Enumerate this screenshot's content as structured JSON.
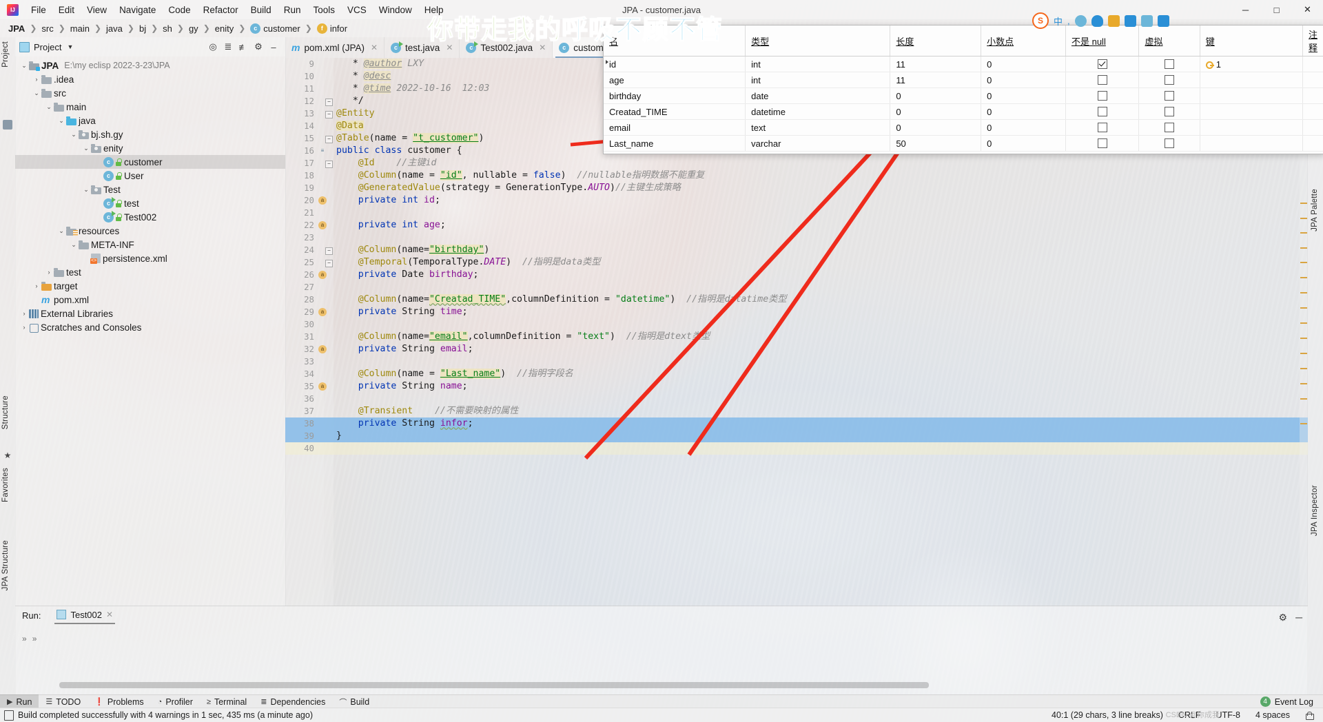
{
  "window": {
    "title": "JPA - customer.java",
    "minimize": "─",
    "maximize": "□",
    "close": "✕"
  },
  "menu": [
    {
      "label": "File"
    },
    {
      "label": "Edit"
    },
    {
      "label": "View"
    },
    {
      "label": "Navigate"
    },
    {
      "label": "Code"
    },
    {
      "label": "Refactor"
    },
    {
      "label": "Build"
    },
    {
      "label": "Run"
    },
    {
      "label": "Tools"
    },
    {
      "label": "VCS"
    },
    {
      "label": "Window"
    },
    {
      "label": "Help"
    }
  ],
  "breadcrumb": [
    {
      "label": "JPA",
      "icon": ""
    },
    {
      "label": "src",
      "icon": ""
    },
    {
      "label": "main",
      "icon": ""
    },
    {
      "label": "java",
      "icon": ""
    },
    {
      "label": "bj",
      "icon": ""
    },
    {
      "label": "sh",
      "icon": ""
    },
    {
      "label": "gy",
      "icon": ""
    },
    {
      "label": "enity",
      "icon": ""
    },
    {
      "label": "customer",
      "icon": "c"
    },
    {
      "label": "infor",
      "icon": "f"
    }
  ],
  "left_strip": [
    {
      "label": "Project"
    },
    {
      "label": "Structure"
    },
    {
      "label": "Favorites"
    },
    {
      "label": "JPA Structure"
    }
  ],
  "right_strip": [
    {
      "label": "JPA Palette"
    },
    {
      "label": "JPA Inspector"
    }
  ],
  "project_panel": {
    "title": "Project",
    "tree": [
      {
        "depth": 0,
        "arrow": "⌄",
        "icon": "mod",
        "label": "JPA",
        "bold": true,
        "sub": "E:\\my eclisp 2022-3-23\\JPA"
      },
      {
        "depth": 1,
        "arrow": "›",
        "icon": "folder",
        "label": ".idea",
        "bold": false,
        "sub": ""
      },
      {
        "depth": 1,
        "arrow": "⌄",
        "icon": "folder",
        "label": "src",
        "bold": false,
        "sub": ""
      },
      {
        "depth": 2,
        "arrow": "⌄",
        "icon": "folder",
        "label": "main",
        "bold": false,
        "sub": ""
      },
      {
        "depth": 3,
        "arrow": "⌄",
        "icon": "blue",
        "label": "java",
        "bold": false,
        "sub": ""
      },
      {
        "depth": 4,
        "arrow": "⌄",
        "icon": "pkg",
        "label": "bj.sh.gy",
        "bold": false,
        "sub": ""
      },
      {
        "depth": 5,
        "arrow": "⌄",
        "icon": "pkg",
        "label": "enity",
        "bold": false,
        "sub": ""
      },
      {
        "depth": 6,
        "arrow": "",
        "icon": "class",
        "label": "customer",
        "bold": false,
        "sub": "",
        "selected": true
      },
      {
        "depth": 6,
        "arrow": "",
        "icon": "class",
        "label": "User",
        "bold": false,
        "sub": ""
      },
      {
        "depth": 5,
        "arrow": "⌄",
        "icon": "pkg",
        "label": "Test",
        "bold": false,
        "sub": ""
      },
      {
        "depth": 6,
        "arrow": "",
        "icon": "class-run",
        "label": "test",
        "bold": false,
        "sub": ""
      },
      {
        "depth": 6,
        "arrow": "",
        "icon": "class-run",
        "label": "Test002",
        "bold": false,
        "sub": ""
      },
      {
        "depth": 3,
        "arrow": "⌄",
        "icon": "res",
        "label": "resources",
        "bold": false,
        "sub": ""
      },
      {
        "depth": 4,
        "arrow": "⌄",
        "icon": "folder",
        "label": "META-INF",
        "bold": false,
        "sub": ""
      },
      {
        "depth": 5,
        "arrow": "",
        "icon": "xml",
        "label": "persistence.xml",
        "bold": false,
        "sub": ""
      },
      {
        "depth": 2,
        "arrow": "›",
        "icon": "folder",
        "label": "test",
        "bold": false,
        "sub": ""
      },
      {
        "depth": 1,
        "arrow": "›",
        "icon": "target",
        "label": "target",
        "bold": false,
        "sub": ""
      },
      {
        "depth": 1,
        "arrow": "",
        "icon": "maven",
        "label": "pom.xml",
        "bold": false,
        "sub": ""
      },
      {
        "depth": 0,
        "arrow": "›",
        "icon": "lib",
        "label": "External Libraries",
        "bold": false,
        "sub": ""
      },
      {
        "depth": 0,
        "arrow": "›",
        "icon": "scratch",
        "label": "Scratches and Consoles",
        "bold": false,
        "sub": ""
      }
    ]
  },
  "editor": {
    "tabs": [
      {
        "label": "pom.xml (JPA)",
        "icon": "m",
        "active": false
      },
      {
        "label": "test.java",
        "icon": "c-run",
        "active": false
      },
      {
        "label": "Test002.java",
        "icon": "c-run",
        "active": false
      },
      {
        "label": "customer.java",
        "icon": "c",
        "active": true
      }
    ],
    "first_line": 9,
    "lines": [
      {
        "n": 9,
        "html": "   * <s class='jtag'>@author</s><s class='jdoc'> LXY</s>"
      },
      {
        "n": 10,
        "html": "   * <s class='jtag'>@desc</s>"
      },
      {
        "n": 11,
        "html": "   * <s class='jtag'>@time</s><s class='jdoc'> 2022-10-16  12:03</s>"
      },
      {
        "n": 12,
        "html": "   */",
        "fold": "minus"
      },
      {
        "n": 13,
        "html": "<s class='ann'>@Entity</s>",
        "fold": "minus2"
      },
      {
        "n": 14,
        "html": "<s class='ann hlstr'>@Data</s>"
      },
      {
        "n": 15,
        "html": "<s class='ann'>@Table</s>(name = <s class='str hlstr und'>\"t_customer\"</s>)",
        "fold": "minus3"
      },
      {
        "n": 16,
        "html": "<s class='kw'>public class </s>customer {",
        "gutter_icon": "bean"
      },
      {
        "n": 17,
        "html": "    <s class='ann'>@Id</s>    <s class='cmt'>//主键id</s>",
        "fold": "minus4"
      },
      {
        "n": 18,
        "html": "    <s class='ann'>@Column</s>(name = <s class='str hlstr und'>\"id\"</s>, nullable = <s class='kw'>false</s>)  <s class='cmt'>//nullable指明数据不能重复</s>"
      },
      {
        "n": 19,
        "html": "    <s class='ann'>@GeneratedValue</s>(strategy = GenerationType.<s class='cnst'>AUTO</s>)<s class='cmt'>//主键生成策略</s>"
      },
      {
        "n": 20,
        "html": "    <s class='kw'>private int </s><s class='fld'>id</s>;",
        "gutter_icon": "a-key"
      },
      {
        "n": 21,
        "html": ""
      },
      {
        "n": 22,
        "html": "    <s class='kw'>private int </s><s class='fld'>age</s>;",
        "gutter_icon": "a"
      },
      {
        "n": 23,
        "html": ""
      },
      {
        "n": 24,
        "html": "    <s class='ann'>@Column</s>(name=<s class='str hlstr und'>\"birthday\"</s>)",
        "fold": "minus5"
      },
      {
        "n": 25,
        "html": "    <s class='ann'>@Temporal</s>(TemporalType.<s class='cnst'>DATE</s>)  <s class='cmt'>//指明是data类型</s>",
        "fold": "minus6"
      },
      {
        "n": 26,
        "html": "    <s class='kw'>private </s>Date <s class='fld'>birthday</s>;",
        "gutter_icon": "a"
      },
      {
        "n": 27,
        "html": ""
      },
      {
        "n": 28,
        "html": "    <s class='ann'>@Column</s>(name=<s class='str hlstr wavy'>\"Creatad_TIME\"</s>,columnDefinition = <s class='str'>\"datetime\"</s>)  <s class='cmt'>//指明是datatime类型</s>"
      },
      {
        "n": 29,
        "html": "    <s class='kw'>private </s>String <s class='fld'>time</s>;",
        "gutter_icon": "a"
      },
      {
        "n": 30,
        "html": ""
      },
      {
        "n": 31,
        "html": "    <s class='ann'>@Column</s>(name=<s class='str hlstr und'>\"email\"</s>,columnDefinition = <s class='str'>\"text\"</s>)  <s class='cmt'>//指明是dtext类型</s>"
      },
      {
        "n": 32,
        "html": "    <s class='kw'>private </s>String <s class='fld'>email</s>;",
        "gutter_icon": "a"
      },
      {
        "n": 33,
        "html": ""
      },
      {
        "n": 34,
        "html": "    <s class='ann'>@Column</s>(name = <s class='str hlstr und'>\"Last_name\"</s>)  <s class='cmt'>//指明字段名</s>"
      },
      {
        "n": 35,
        "html": "    <s class='kw'>private </s>String <s class='fld'>name</s>;",
        "gutter_icon": "a"
      },
      {
        "n": 36,
        "html": ""
      },
      {
        "n": 37,
        "html": "    <s class='ann'>@Transient</s>    <s class='cmt'>//不需要映射的属性</s>"
      },
      {
        "n": 38,
        "html": "    <s class='kw'>private </s>String <s class='fld wavy'>infor</s>;",
        "selected": true
      },
      {
        "n": 39,
        "html": "}",
        "selected": true
      },
      {
        "n": 40,
        "html": "",
        "caret": true
      }
    ]
  },
  "db_window": {
    "headers": [
      "名",
      "类型",
      "长度",
      "小数点",
      "不是 null",
      "虚拟",
      "键",
      "注释"
    ],
    "rows": [
      {
        "name": "id",
        "type": "int",
        "length": "11",
        "decimals": "0",
        "notnull": true,
        "virtual": false,
        "key": "1",
        "comment": "",
        "marker": true
      },
      {
        "name": "age",
        "type": "int",
        "length": "11",
        "decimals": "0",
        "notnull": false,
        "virtual": false,
        "key": "",
        "comment": ""
      },
      {
        "name": "birthday",
        "type": "date",
        "length": "0",
        "decimals": "0",
        "notnull": false,
        "virtual": false,
        "key": "",
        "comment": ""
      },
      {
        "name": "Creatad_TIME",
        "type": "datetime",
        "length": "0",
        "decimals": "0",
        "notnull": false,
        "virtual": false,
        "key": "",
        "comment": ""
      },
      {
        "name": "email",
        "type": "text",
        "length": "0",
        "decimals": "0",
        "notnull": false,
        "virtual": false,
        "key": "",
        "comment": ""
      },
      {
        "name": "Last_name",
        "type": "varchar",
        "length": "50",
        "decimals": "0",
        "notnull": false,
        "virtual": false,
        "key": "",
        "comment": ""
      }
    ]
  },
  "ime_toolbar": {
    "logo": "S",
    "mode": "中",
    "items": [
      "comma-icon",
      "smiley-icon",
      "mic-icon",
      "pen-icon",
      "screenshot-icon",
      "translate-icon",
      "apps-icon"
    ]
  },
  "watermark": {
    "green": "你带走我的",
    "blue": "呼吸不顾不管"
  },
  "run_window": {
    "label": "Run:",
    "tab": "Test002",
    "close": "✕",
    "gear": "⚙",
    "minimize": "─",
    "side_icons": [
      "»",
      "»"
    ]
  },
  "bottom_toolbar": {
    "buttons": [
      {
        "label": "Run",
        "icon": "play-icon",
        "active": true
      },
      {
        "label": "TODO",
        "icon": "list-icon",
        "active": false
      },
      {
        "label": "Problems",
        "icon": "warning-icon",
        "active": false
      },
      {
        "label": "Profiler",
        "icon": "gauge-icon",
        "active": false
      },
      {
        "label": "Terminal",
        "icon": "terminal-icon",
        "active": false
      },
      {
        "label": "Dependencies",
        "icon": "layers-icon",
        "active": false
      },
      {
        "label": "Build",
        "icon": "hammer-icon",
        "active": false
      }
    ],
    "event_log": {
      "label": "Event Log",
      "count": "4"
    }
  },
  "status_bar": {
    "message": "Build completed successfully with 4 warnings in 1 sec, 435 ms (a minute ago)",
    "caret": "40:1 (29 chars, 3 line breaks)",
    "line_sep": "CRLF",
    "encoding": "UTF-8",
    "indent": "4 spaces"
  },
  "watermark_credit": "CSDN @你成我"
}
